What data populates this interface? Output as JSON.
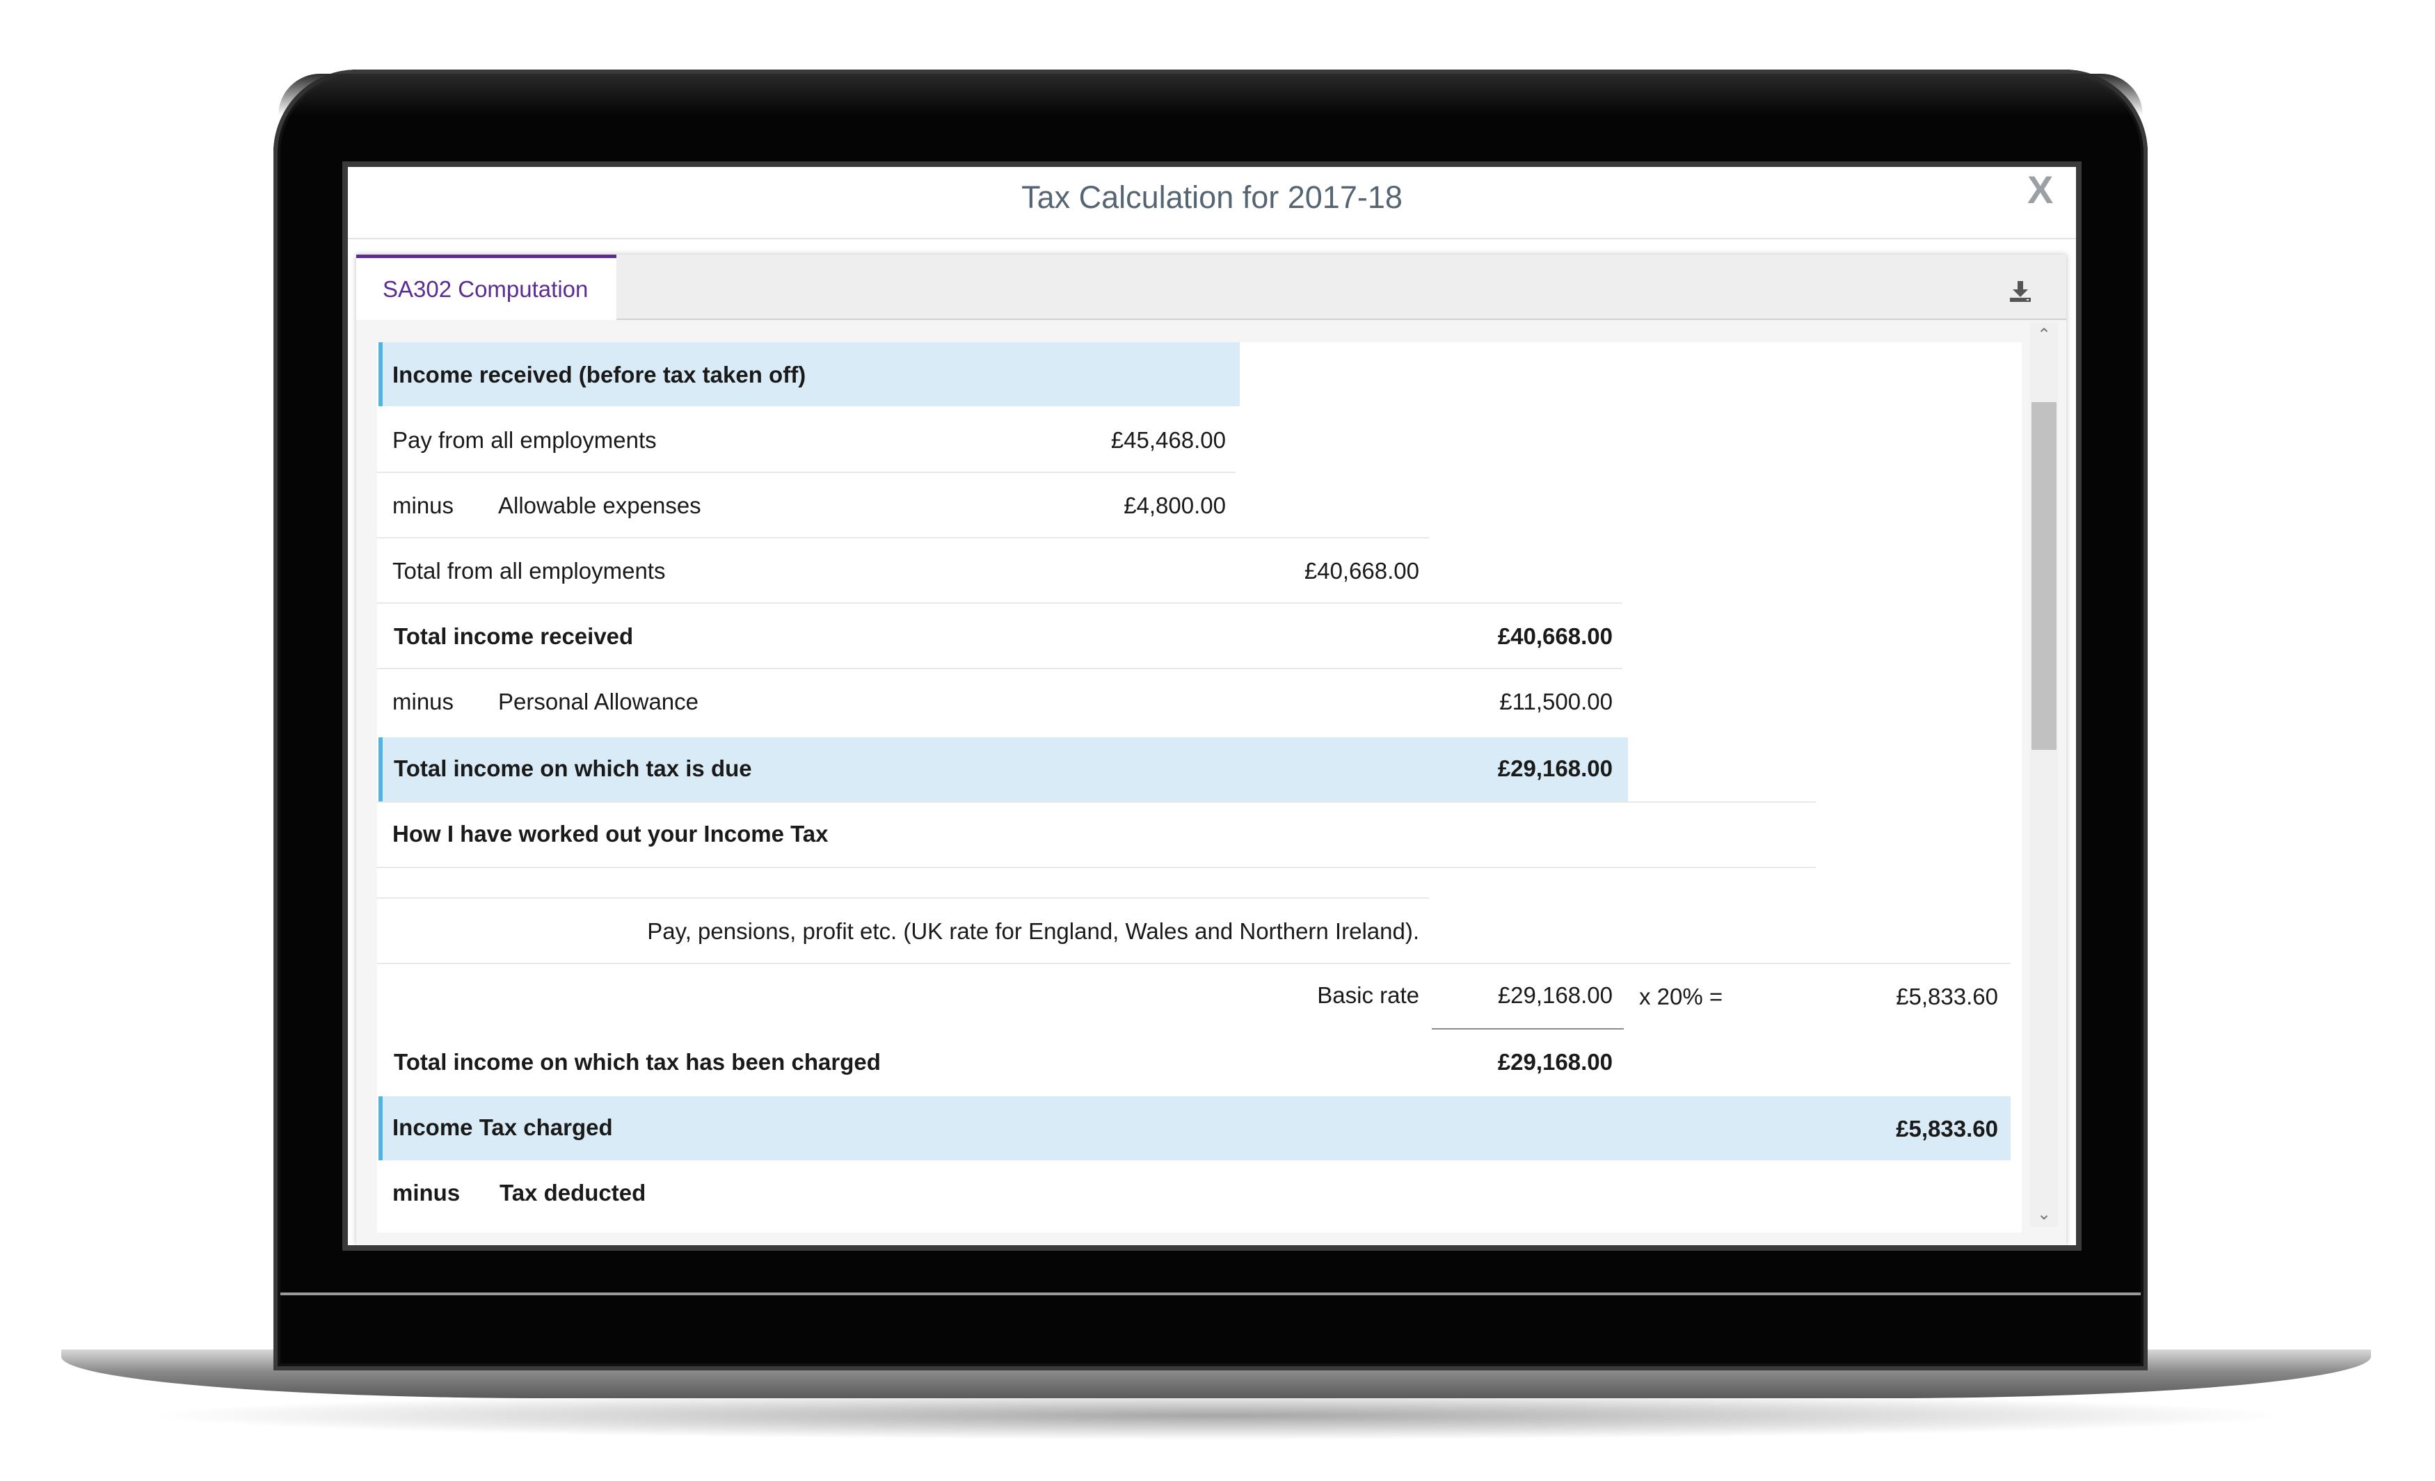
{
  "modal": {
    "title": "Tax Calculation for 2017-18",
    "close": "X"
  },
  "tabs": {
    "active_label": "SA302 Computation"
  },
  "computation": {
    "income_header": "Income received (before tax taken off)",
    "pay_label": "Pay from all employments",
    "pay_value": "£45,468.00",
    "minus1": "minus",
    "allowable_label": "Allowable expenses",
    "allowable_value": "£4,800.00",
    "total_employment_label": "Total from all employments",
    "total_employment_value": "£40,668.00",
    "total_income_label": "Total income received",
    "total_income_value": "£40,668.00",
    "minus2": "minus",
    "personal_allowance_label": "Personal Allowance",
    "personal_allowance_value": "£11,500.00",
    "tax_due_label": "Total income on which tax is due",
    "tax_due_value": "£29,168.00",
    "how_label": "How I have worked out your Income Tax",
    "pay_pensions_label": "Pay, pensions, profit etc. (UK rate for England, Wales and Northern Ireland).",
    "basic_rate_label": "Basic rate",
    "basic_rate_amount": "£29,168.00",
    "basic_rate_multiplier": "x 20% =",
    "basic_rate_tax": "£5,833.60",
    "charged_total_label": "Total income on which tax has been charged",
    "charged_total_value": "£29,168.00",
    "income_tax_charged_label": "Income Tax charged",
    "income_tax_charged_value": "£5,833.60",
    "minus3": "minus",
    "tax_deducted_label": "Tax deducted"
  },
  "icons": {
    "download": "download-icon",
    "scroll_up": "chevron-up-icon",
    "scroll_down": "chevron-down-icon"
  },
  "colors": {
    "tab_accent": "#5b2c91",
    "highlight_bg": "#d9ebf6",
    "highlight_border": "#4fb4e0",
    "title": "#566573"
  }
}
